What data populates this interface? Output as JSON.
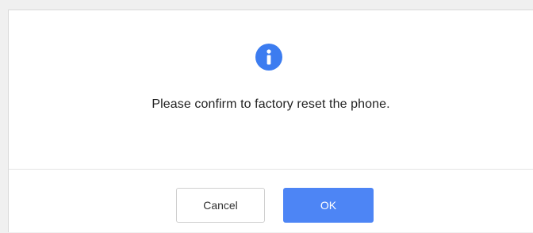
{
  "dialog": {
    "icon": "info-icon",
    "message": "Please confirm to factory reset the phone.",
    "cancel_label": "Cancel",
    "ok_label": "OK"
  },
  "colors": {
    "accent": "#4d85f5",
    "icon_bg": "#3c7cf0"
  }
}
